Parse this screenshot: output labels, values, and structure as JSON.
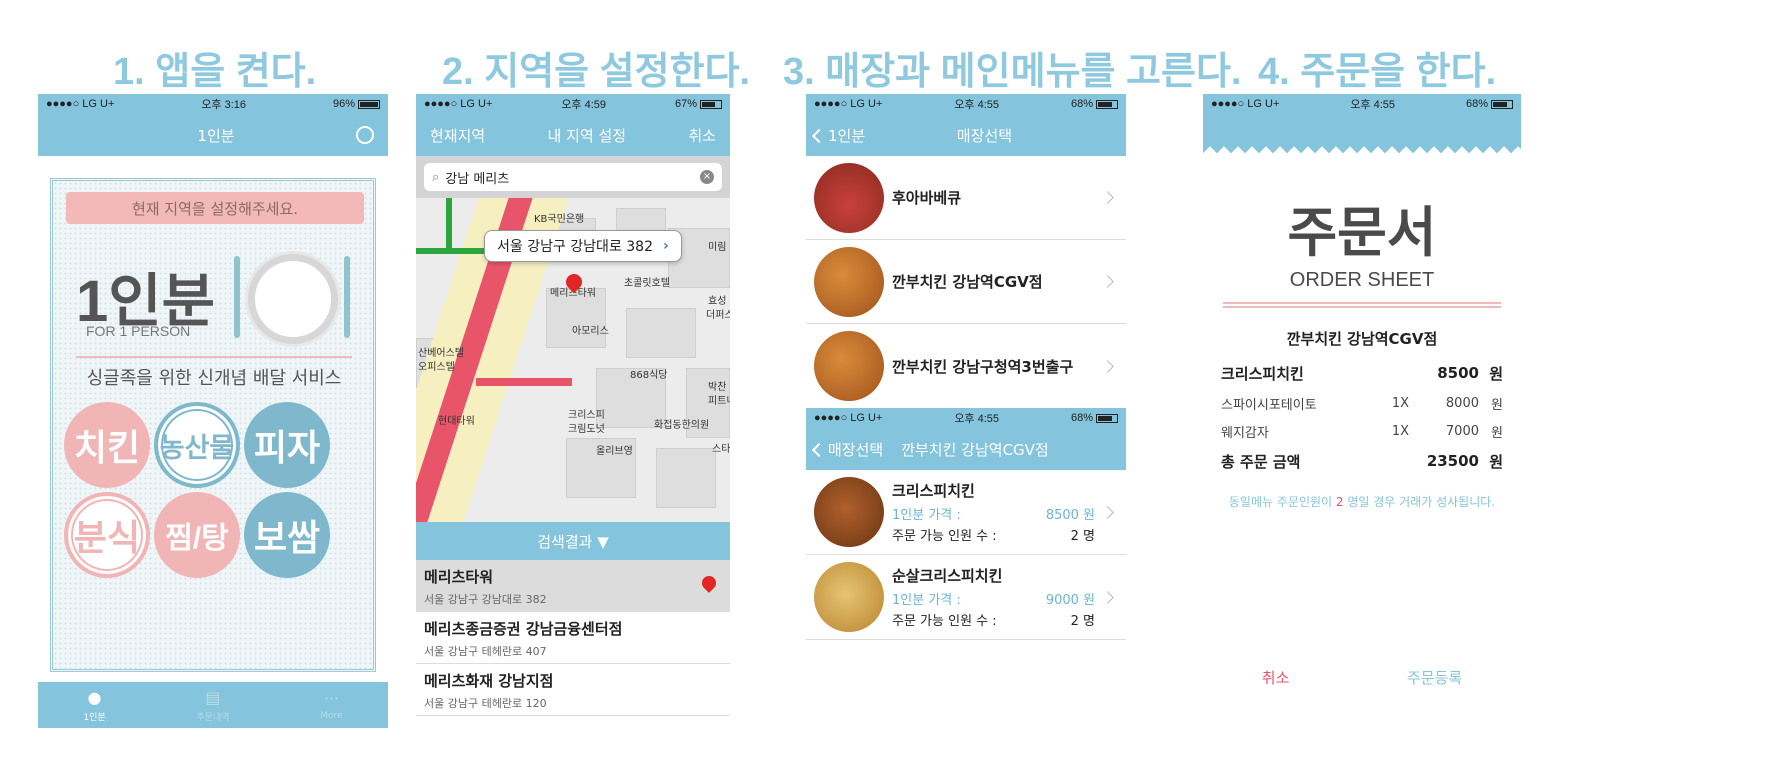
{
  "steps": [
    {
      "title": "1. 앱을 켠다."
    },
    {
      "title": "2. 지역을 설정한다."
    },
    {
      "title": "3. 매장과 메인메뉴를 고른다."
    },
    {
      "title": "4. 주문을 한다."
    }
  ],
  "phone1": {
    "status": {
      "carrier": "●●●●○ LG U+",
      "time": "오후 3:16",
      "battery": "96%"
    },
    "nav_title": "1인분",
    "notice": "현재 지역을 설정해주세요.",
    "brand": "1인분",
    "brand_sub": "FOR 1 PERSON",
    "tagline": "싱글족을 위한 신개념 배달 서비스",
    "categories": [
      "치킨",
      "농산물",
      "피자",
      "분식",
      "찜/탕",
      "보쌈"
    ],
    "tabs": [
      "1인분",
      "주문내역",
      "More"
    ]
  },
  "phone2": {
    "status": {
      "carrier": "●●●●○ LG U+",
      "time": "오후 4:59",
      "battery": "67%"
    },
    "nav_left": "현재지역",
    "nav_title": "내 지역 설정",
    "nav_right": "취소",
    "search_value": "강남 메리츠",
    "callout": "서울 강남구 강남대로 382",
    "map_labels": [
      "KB국민은행",
      "미림",
      "메리츠타워",
      "초콜릿호텔",
      "아모리스",
      "효성",
      "더퍼스",
      "산베어스텔",
      "오피스텔",
      "868식당",
      "박찬",
      "피트니",
      "크리스피",
      "크림도넛",
      "화접동한의원",
      "현대타워",
      "올리브영",
      "스타"
    ],
    "results_head": "검색결과 ▼",
    "results": [
      {
        "name": "메리츠타워",
        "addr": "서울 강남구 강남대로 382"
      },
      {
        "name": "메리츠종금증권 강남금융센터점",
        "addr": "서울 강남구 테헤란로 407"
      },
      {
        "name": "메리츠화재 강남지점",
        "addr": "서울 강남구 테헤란로 120"
      }
    ]
  },
  "phone3": {
    "status1": {
      "carrier": "●●●●○ LG U+",
      "time": "오후 4:55",
      "battery": "68%"
    },
    "nav1_back": "1인분",
    "nav1_title": "매장선택",
    "stores": [
      "후아바베큐",
      "깐부치킨 강남역CGV점",
      "깐부치킨 강남구청역3번출구"
    ],
    "status2": {
      "carrier": "●●●●○ LG U+",
      "time": "오후 4:55",
      "battery": "68%"
    },
    "nav2_back": "매장선택",
    "nav2_title": "깐부치킨 강남역CGV점",
    "menu": [
      {
        "name": "크리스피치킨",
        "price_label": "1인분 가격 :",
        "price": "8500 원",
        "people_label": "주문 가능 인원 수 :",
        "people": "2 명"
      },
      {
        "name": "순살크리스피치킨",
        "price_label": "1인분 가격 :",
        "price": "9000 원",
        "people_label": "주문 가능 인원 수 :",
        "people": "2 명"
      }
    ]
  },
  "phone4": {
    "status": {
      "carrier": "●●●●○ LG U+",
      "time": "오후 4:55",
      "battery": "68%"
    },
    "title": "주문서",
    "subtitle": "ORDER SHEET",
    "store": "깐부치킨 강남역CGV점",
    "main_item": {
      "name": "크리스피치킨",
      "price": "8500",
      "unit": "원"
    },
    "sides": [
      {
        "name": "스파이시포테이토",
        "qty": "1X",
        "price": "8000",
        "unit": "원"
      },
      {
        "name": "웨지감자",
        "qty": "1X",
        "price": "7000",
        "unit": "원"
      }
    ],
    "total": {
      "label": "총 주문 금액",
      "price": "23500",
      "unit": "원"
    },
    "note_pre": "동일메뉴 주문인원이 ",
    "note_num": "2",
    "note_post": " 명일 경우 거래가 성사됩니다.",
    "cancel": "취소",
    "submit": "주문등록"
  }
}
